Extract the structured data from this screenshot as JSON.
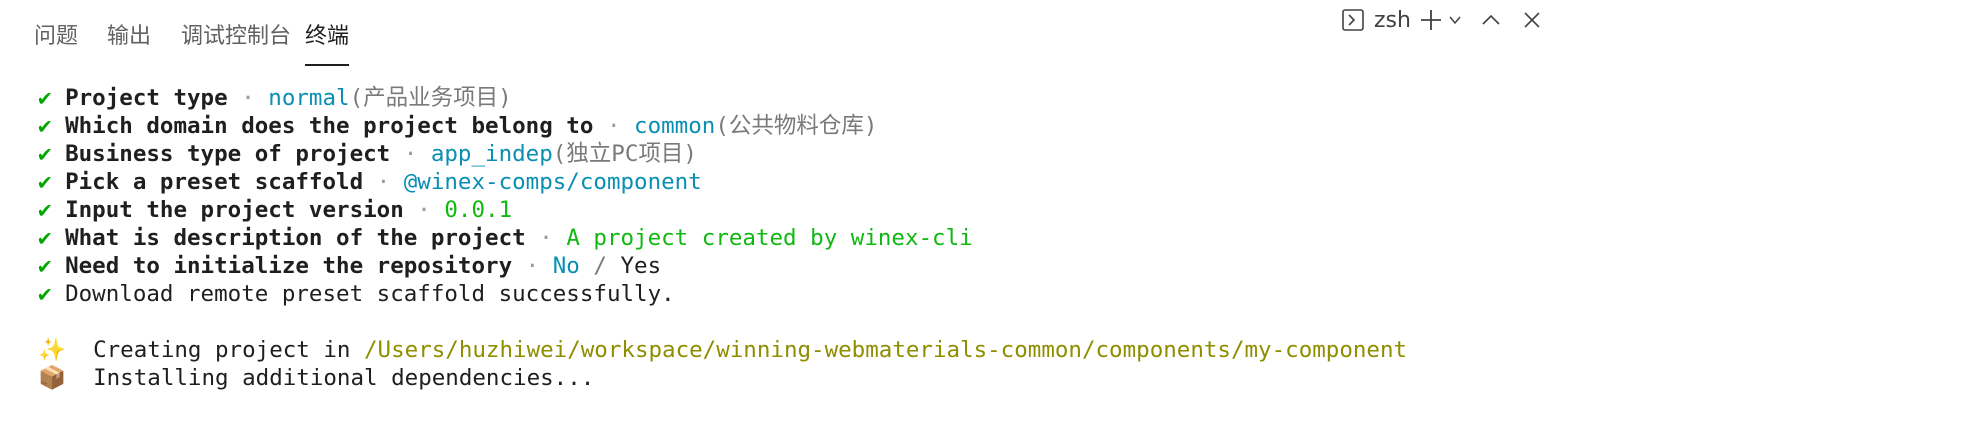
{
  "tabs": [
    {
      "label": "问题",
      "active": false
    },
    {
      "label": "输出",
      "active": false
    },
    {
      "label": "调试控制台",
      "active": false
    },
    {
      "label": "终端",
      "active": true
    }
  ],
  "toolbar": {
    "shell_icon": "terminal-icon",
    "shell_name": "zsh",
    "add_icon": "plus-icon",
    "dropdown_icon": "chevron-down-icon",
    "maximize_icon": "chevron-up-icon",
    "close_icon": "close-icon"
  },
  "terminal": {
    "check_glyph": "✔",
    "separator": "·",
    "prompts": [
      {
        "question": "Project type",
        "answer": "normal",
        "note": "(产品业务项目)",
        "answer_color": "cyan"
      },
      {
        "question": "Which domain does the project belong to",
        "answer": "common",
        "note": "(公共物料仓库)",
        "answer_color": "cyan"
      },
      {
        "question": "Business type of project",
        "answer": "app_indep",
        "note": "(独立PC项目)",
        "answer_color": "cyan"
      },
      {
        "question": "Pick a preset scaffold",
        "answer": "@winex-comps/component",
        "note": "",
        "answer_color": "cyan"
      },
      {
        "question": "Input the project version",
        "answer": "0.0.1",
        "note": "",
        "answer_color": "green"
      },
      {
        "question": "What is description of the project",
        "answer": "A project created by winex-cli",
        "note": "",
        "answer_color": "green"
      },
      {
        "question": "Need to initialize the repository",
        "answer": "No",
        "slash": "/",
        "other": "Yes",
        "answer_color": "cyan"
      }
    ],
    "download_msg": "Download remote preset scaffold successfully.",
    "creating": {
      "emoji": "✨",
      "text": "  Creating project in ",
      "path": "/Users/huzhiwei/workspace/winning-webmaterials-common/components/my-component"
    },
    "installing": {
      "emoji": "📦",
      "text": "  Installing additional dependencies..."
    }
  },
  "colors": {
    "check": "#00a800",
    "cyan": "#0a8fb3",
    "green": "#12b812",
    "path": "#8e8e00"
  }
}
